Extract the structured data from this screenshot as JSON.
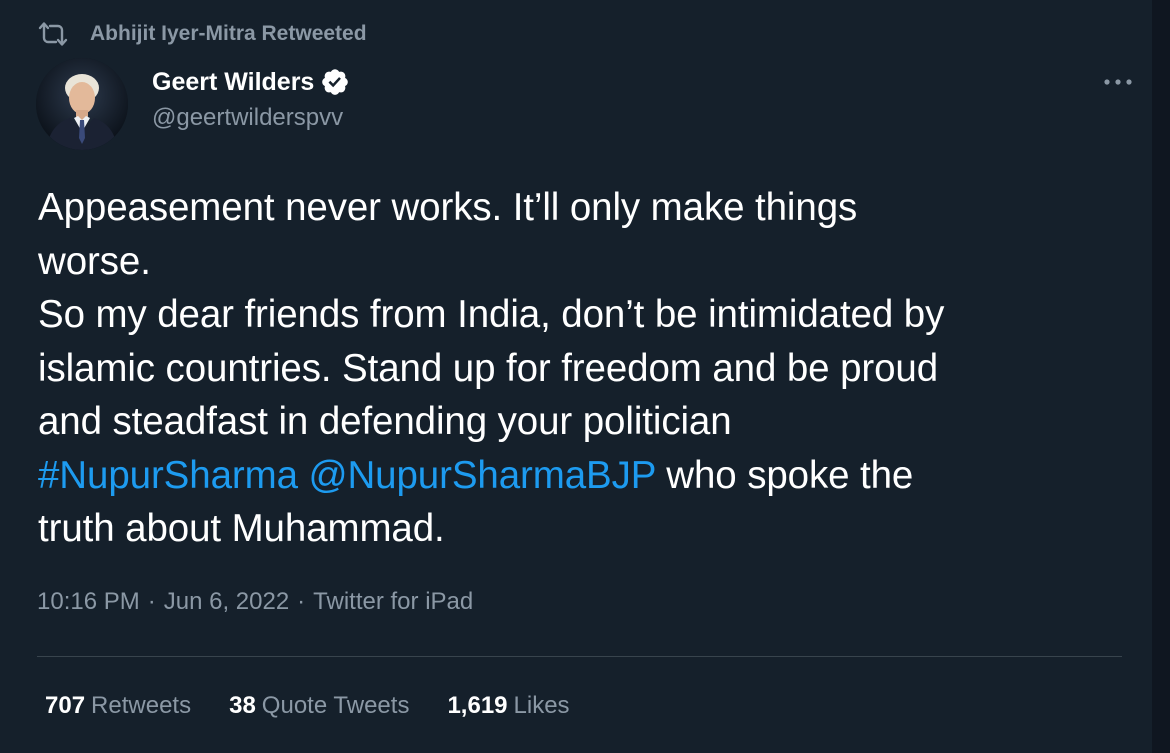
{
  "retweet_context": {
    "icon": "retweet-icon",
    "text": "Abhijit Iyer-Mitra Retweeted"
  },
  "author": {
    "display_name": "Geert Wilders",
    "handle": "@geertwilderspvv",
    "verified": true,
    "verified_icon": "verified-badge-icon",
    "avatar": "avatar"
  },
  "more_icon": "more-options-icon",
  "tweet": {
    "lines": {
      "line1": "Appeasement never works. It’ll only make things",
      "line2": "worse.",
      "line3": "So my dear friends from India, don’t be intimidated by",
      "line4": "islamic countries. Stand up for freedom and be proud",
      "line5": "and steadfast in defending your politician",
      "hashtag": "#NupurSharma",
      "mention": "@NupurSharmaBJP",
      "line6_rest": " who spoke the",
      "line7": "truth about Muhammad."
    }
  },
  "meta": {
    "time": "10:16 PM",
    "separator": "·",
    "date": "Jun 6, 2022",
    "source": "Twitter for iPad"
  },
  "stats": {
    "retweets": {
      "count": "707",
      "label": "Retweets"
    },
    "quote_tweets": {
      "count": "38",
      "label": "Quote Tweets"
    },
    "likes": {
      "count": "1,619",
      "label": "Likes"
    }
  },
  "colors": {
    "background": "#15202b",
    "text_primary": "#ffffff",
    "text_secondary": "#8b98a5",
    "link": "#1d9bf0",
    "divider": "#38444d"
  }
}
